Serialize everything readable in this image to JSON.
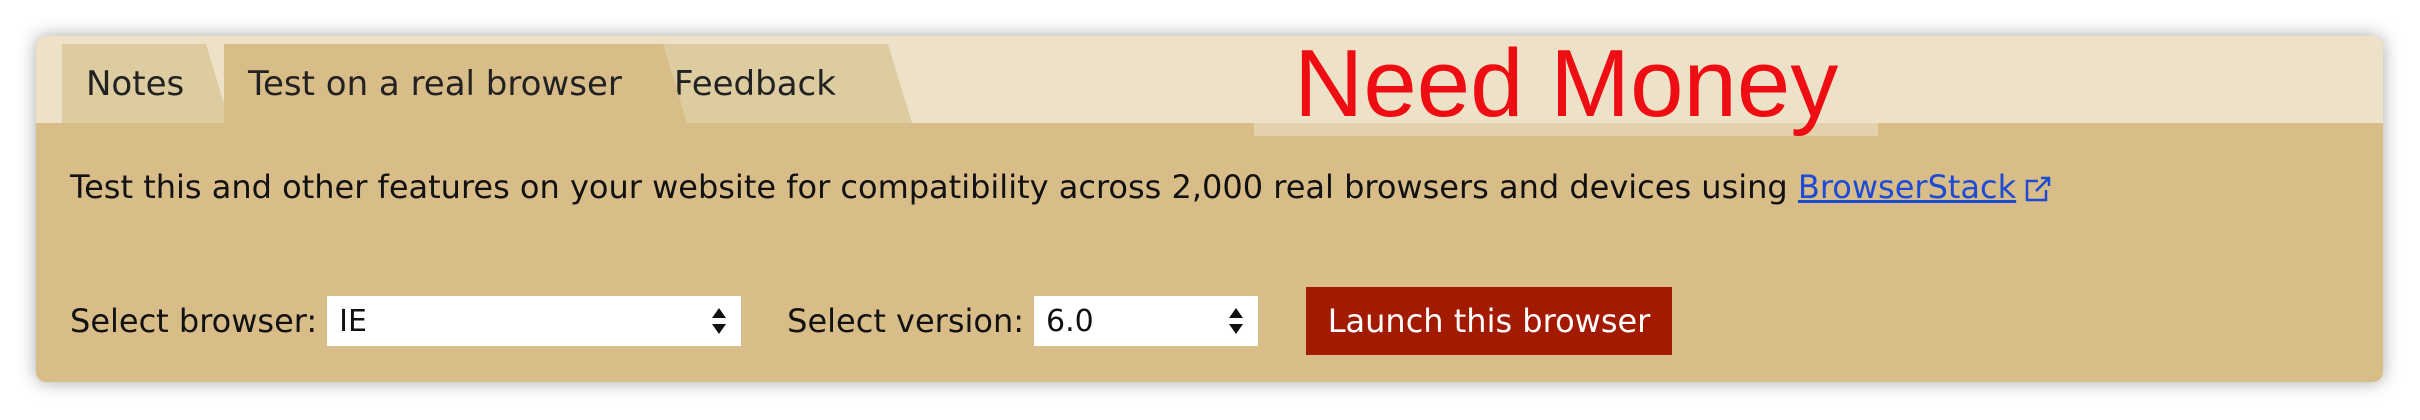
{
  "tabs": {
    "notes": "Notes",
    "test": "Test on a real browser",
    "feedback": "Feedback"
  },
  "watermark": "Need Money",
  "description": {
    "text": "Test this and other features on your website for compatibility across 2,000 real browsers and devices using ",
    "link_text": "BrowserStack"
  },
  "browser_select": {
    "label": "Select browser:",
    "value": "IE"
  },
  "version_select": {
    "label": "Select version:",
    "value": "6.0"
  },
  "launch_button": "Launch this browser",
  "colors": {
    "panel": "#d8bd88",
    "tabbar": "#ede2c8",
    "launch": "#a21a00",
    "link": "#1d4bd6",
    "watermark": "#ee0d12"
  }
}
